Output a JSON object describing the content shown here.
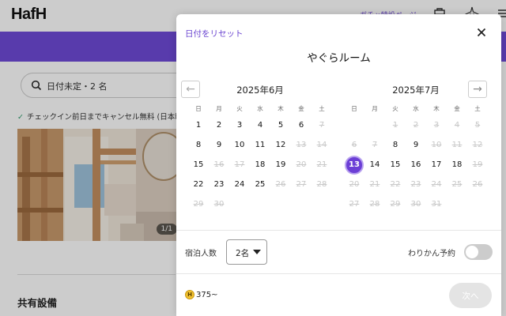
{
  "background": {
    "logo": "HafH",
    "top_link": "ガチャ特設ページ",
    "search": {
      "text": "日付未定・2 名"
    },
    "cancel_text": "チェックイン前日までキャンセル無料 (日本時",
    "photo_counter": "1/1",
    "section_title": "共有設備"
  },
  "modal": {
    "reset_label": "日付をリセット",
    "title": "やぐらルーム",
    "weekdays": [
      "日",
      "月",
      "火",
      "水",
      "木",
      "金",
      "土"
    ],
    "months": [
      {
        "title": "2025年6月",
        "weeks": [
          [
            {
              "d": "1"
            },
            {
              "d": "2"
            },
            {
              "d": "3"
            },
            {
              "d": "4"
            },
            {
              "d": "5"
            },
            {
              "d": "6"
            },
            {
              "d": "7",
              "disabled": true
            }
          ],
          [
            {
              "d": "8"
            },
            {
              "d": "9"
            },
            {
              "d": "10"
            },
            {
              "d": "11"
            },
            {
              "d": "12"
            },
            {
              "d": "13",
              "disabled": true
            },
            {
              "d": "14",
              "disabled": true
            }
          ],
          [
            {
              "d": "15"
            },
            {
              "d": "16",
              "disabled": true
            },
            {
              "d": "17",
              "disabled": true
            },
            {
              "d": "18"
            },
            {
              "d": "19"
            },
            {
              "d": "20",
              "disabled": true
            },
            {
              "d": "21",
              "disabled": true
            }
          ],
          [
            {
              "d": "22"
            },
            {
              "d": "23"
            },
            {
              "d": "24"
            },
            {
              "d": "25"
            },
            {
              "d": "26",
              "disabled": true
            },
            {
              "d": "27",
              "disabled": true
            },
            {
              "d": "28",
              "disabled": true
            }
          ],
          [
            {
              "d": "29",
              "disabled": true
            },
            {
              "d": "30",
              "disabled": true
            },
            {
              "d": ""
            },
            {
              "d": ""
            },
            {
              "d": ""
            },
            {
              "d": ""
            },
            {
              "d": ""
            }
          ]
        ]
      },
      {
        "title": "2025年7月",
        "weeks": [
          [
            {
              "d": ""
            },
            {
              "d": ""
            },
            {
              "d": "1",
              "disabled": true
            },
            {
              "d": "2",
              "disabled": true
            },
            {
              "d": "3",
              "disabled": true
            },
            {
              "d": "4",
              "disabled": true
            },
            {
              "d": "5",
              "disabled": true
            }
          ],
          [
            {
              "d": "6",
              "disabled": true
            },
            {
              "d": "7",
              "disabled": true
            },
            {
              "d": "8"
            },
            {
              "d": "9"
            },
            {
              "d": "10",
              "disabled": true
            },
            {
              "d": "11",
              "disabled": true
            },
            {
              "d": "12",
              "disabled": true
            }
          ],
          [
            {
              "d": "13",
              "selected": true
            },
            {
              "d": "14"
            },
            {
              "d": "15"
            },
            {
              "d": "16"
            },
            {
              "d": "17"
            },
            {
              "d": "18"
            },
            {
              "d": "19",
              "disabled": true
            }
          ],
          [
            {
              "d": "20",
              "disabled": true
            },
            {
              "d": "21",
              "disabled": true
            },
            {
              "d": "22",
              "disabled": true
            },
            {
              "d": "23",
              "disabled": true
            },
            {
              "d": "24",
              "disabled": true
            },
            {
              "d": "25",
              "disabled": true
            },
            {
              "d": "26",
              "disabled": true
            }
          ],
          [
            {
              "d": "27",
              "disabled": true
            },
            {
              "d": "28",
              "disabled": true
            },
            {
              "d": "29",
              "disabled": true
            },
            {
              "d": "30",
              "disabled": true
            },
            {
              "d": "31",
              "disabled": true
            },
            {
              "d": ""
            },
            {
              "d": ""
            }
          ]
        ]
      }
    ],
    "guest_label": "宿泊人数",
    "guest_value": "2名",
    "split_label": "わりかん予約",
    "split_enabled": false,
    "coin_text": "375~",
    "next_label": "次へ",
    "colors": {
      "accent": "#6c3fd6",
      "band": "#6f4ad8",
      "coin": "#f2c230"
    }
  }
}
